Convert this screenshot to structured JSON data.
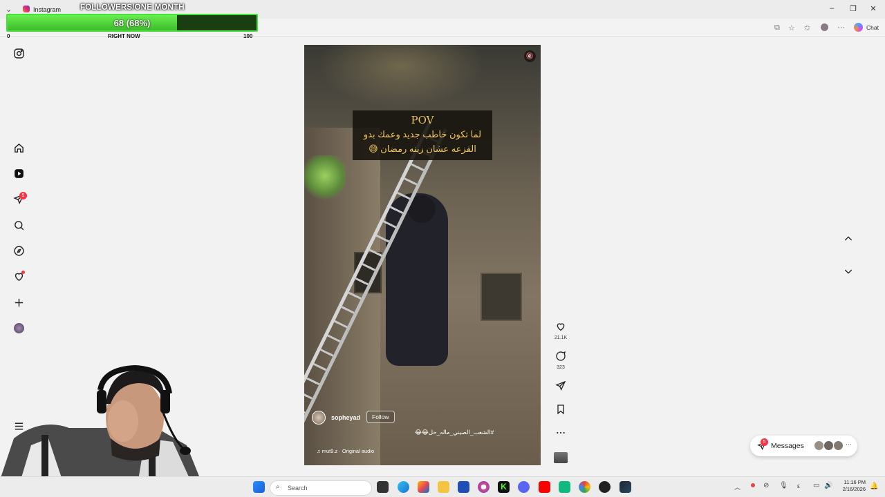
{
  "browser": {
    "tab_title": "Instagram",
    "chat_label": "Chat"
  },
  "follower_overlay": {
    "title": "FOLLOWERS/ONE MONTH",
    "value_text": "68 (68%)",
    "progress_fraction": 0.68,
    "min_label": "0",
    "mid_label": "RIGHT NOW",
    "max_label": "100"
  },
  "sidebar": {
    "notification_badge": "5"
  },
  "reel": {
    "caption_title": "POV",
    "caption_line1": "لما تكون خاطب جديد وعمك بدو",
    "caption_line2": "الفزعه عشان زينه رمضان 😅",
    "author": "sopheyad",
    "follow_label": "Follow",
    "hashtag": "#الشعب_الصيني_ماله_حل😂😂",
    "audio": "mut9.z · Original audio"
  },
  "actions": {
    "likes": "21.1K",
    "comments": "323"
  },
  "messages": {
    "label": "Messages",
    "badge": "5"
  },
  "taskbar": {
    "search_placeholder": "Search",
    "time": "11:16 PM",
    "date": "2/16/2026"
  },
  "colors": {
    "overlay_green": "#48e03c",
    "badge_red": "#ff3040",
    "caption_gold": "#f0c75e"
  }
}
